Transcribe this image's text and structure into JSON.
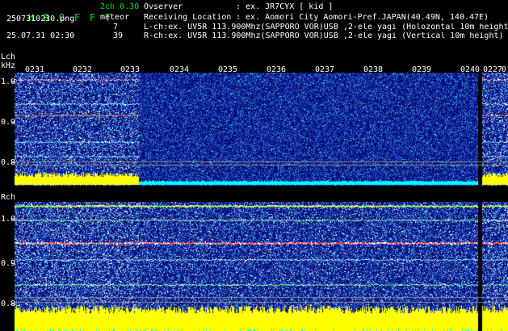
{
  "app": {
    "title_letters": [
      "H",
      "R",
      "O",
      "F",
      "F",
      "T"
    ],
    "mode": "2ch 0.30",
    "meteor_label": "meteor",
    "filename": "2507310230.png",
    "datetime": "25.07.31 02:30",
    "meteor_count_l": "7",
    "meteor_count_r": "39"
  },
  "info": {
    "observer_label": "Ovserver",
    "observer_value": ": ex. JR7CYX [ kid ]",
    "location_label": "Receiving Location",
    "location_value": ": ex. Aomori City Aomori-Pref.JAPAN(40.49N, 140.47E)",
    "lch_line": "L-ch:ex. UV5R 113.900Mhz(SAPPORO VOR)USB ,2-ele yagi (Holozontal 10m height)",
    "rch_line": "R-ch:ex. UV5R 113.900Mhz(SAPPORO VOR)USB ,2-ele yagi (Vertical 10m height)"
  },
  "lch": {
    "label": "Lch",
    "unit": "kHz",
    "y_ticks": [
      "1.0",
      "0.9",
      "0.8"
    ]
  },
  "rch": {
    "label": "Rch",
    "y_ticks": [
      "1.0",
      "0.9",
      "0.8"
    ]
  },
  "time_ticks": [
    "0231",
    "0232",
    "0233",
    "0234",
    "0235",
    "0236",
    "0237",
    "0238",
    "0239",
    "0240",
    "0227",
    "0"
  ],
  "colors": {
    "header_green": "#00e000",
    "level_yellow": "#ffff00",
    "level_cyan": "#00ffff",
    "noise_blue": "#0a1e9a"
  }
}
